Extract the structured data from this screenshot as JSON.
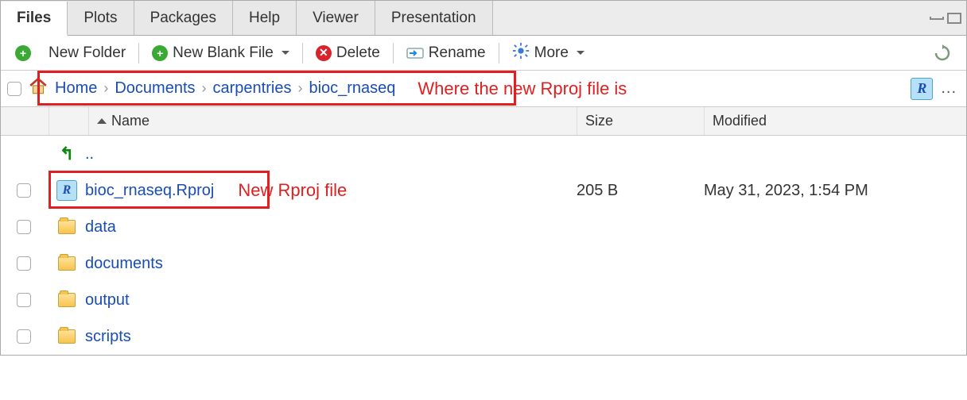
{
  "tabs": {
    "files": "Files",
    "plots": "Plots",
    "packages": "Packages",
    "help": "Help",
    "viewer": "Viewer",
    "presentation": "Presentation"
  },
  "toolbar": {
    "new_folder": "New Folder",
    "new_blank_file": "New Blank File",
    "delete": "Delete",
    "rename": "Rename",
    "more": "More"
  },
  "breadcrumb": {
    "home": "Home",
    "documents": "Documents",
    "carpentries": "carpentries",
    "bioc_rnaseq": "bioc_rnaseq"
  },
  "annotations": {
    "breadcrumb": "Where the new Rproj file is",
    "rproj": "New Rproj file"
  },
  "columns": {
    "name": "Name",
    "size": "Size",
    "modified": "Modified"
  },
  "files": {
    "up": "..",
    "rproj": {
      "name": "bioc_rnaseq.Rproj",
      "size": "205 B",
      "modified": "May 31, 2023, 1:54 PM"
    },
    "data": "data",
    "documents": "documents",
    "output": "output",
    "scripts": "scripts"
  },
  "glyphs": {
    "rproj_r": "R",
    "ellipsis": "..."
  }
}
